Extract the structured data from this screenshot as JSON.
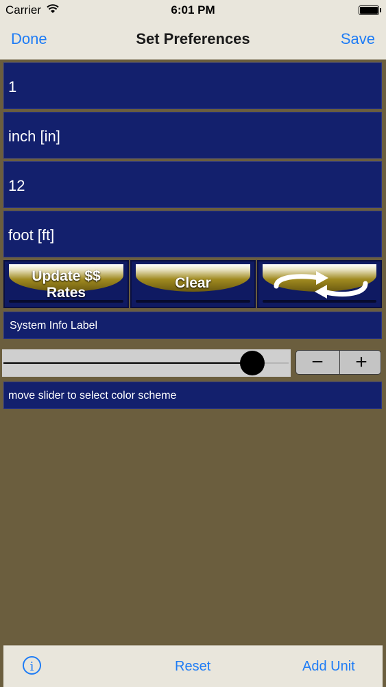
{
  "status_bar": {
    "carrier": "Carrier",
    "time": "6:01 PM"
  },
  "nav": {
    "left": "Done",
    "title": "Set Preferences",
    "right": "Save"
  },
  "fields": [
    "1",
    "inch [in]",
    "12",
    "foot [ft]"
  ],
  "buttons": {
    "update_line1": "Update $$",
    "update_line2": "Rates",
    "clear": "Clear",
    "swap_icon": "swap-arrows-icon"
  },
  "info_label": "System Info Label",
  "slider": {
    "value_fraction": 0.87
  },
  "stepper": {
    "minus": "−",
    "plus": "+"
  },
  "hint": "move slider to select color scheme",
  "toolbar": {
    "info_icon": "i",
    "reset": "Reset",
    "add_unit": "Add Unit"
  },
  "colors": {
    "background": "#6b5e3e",
    "field": "#13206d",
    "accent": "#1e7cf5",
    "bar": "#e9e6dc"
  }
}
